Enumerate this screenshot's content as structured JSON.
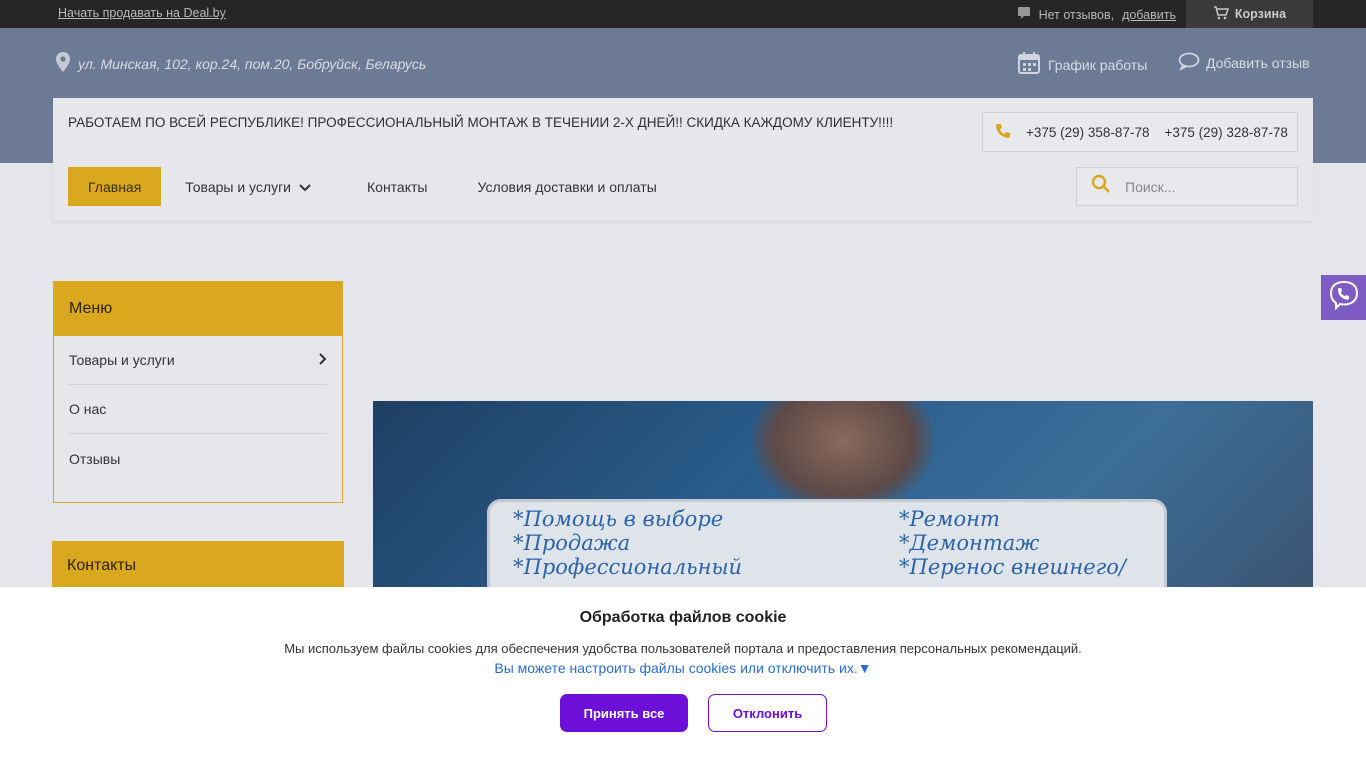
{
  "topbar": {
    "sell_link": "Начать продавать на Deal.by",
    "reviews_text": "Нет отзывов,",
    "reviews_add": "добавить",
    "cart_label": "Корзина"
  },
  "header": {
    "address": "ул. Минская, 102, кор.24, пом.20, Бобруйск, Беларусь",
    "schedule_label": "График работы",
    "add_review_label": "Добавить отзыв",
    "promo": "РАБОТАЕМ ПО ВСЕЙ РЕСПУБЛИКЕ! ПРОФЕССИОНАЛЬНЫЙ МОНТАЖ В ТЕЧЕНИИ 2-Х ДНЕЙ!! СКИДКА КАЖДОМУ КЛИЕНТУ!!!!",
    "phones": [
      "+375 (29) 358-87-78",
      "+375 (29) 328-87-78"
    ]
  },
  "nav": {
    "items": [
      {
        "label": "Главная"
      },
      {
        "label": "Товары и услуги"
      },
      {
        "label": "Контакты"
      },
      {
        "label": "Условия доставки и оплаты"
      }
    ],
    "search_placeholder": "Поиск..."
  },
  "sidebar": {
    "menu_title": "Меню",
    "items": [
      {
        "label": "Товары и услуги"
      },
      {
        "label": "О нас"
      },
      {
        "label": "Отзывы"
      }
    ],
    "contacts_title": "Контакты"
  },
  "banner": {
    "left_lines": [
      "*Помощь в выборе",
      "*Продажа",
      "*Профессиональный"
    ],
    "right_lines": [
      "*Ремонт",
      "*Демонтаж",
      "*Перенос внешнего/"
    ]
  },
  "cookie": {
    "title": "Обработка файлов cookie",
    "text": "Мы используем файлы cookies для обеспечения удобства пользователей портала и предоставления персональных рекомендаций.",
    "link": "Вы можете настроить файлы cookies или отключить их.▼",
    "accept_label": "Принять все",
    "decline_label": "Отклонить"
  },
  "colors": {
    "accent": "#d9a81e",
    "cookie_button": "#6b0fd9",
    "viber": "#7e5cc4",
    "topbar": "#262626"
  },
  "icons": [
    "location-icon",
    "comment-icon",
    "cart-icon",
    "calendar-icon",
    "chat-bubble-icon",
    "phone-icon",
    "search-icon",
    "chevron-down-icon",
    "chevron-right-icon",
    "viber-icon"
  ]
}
